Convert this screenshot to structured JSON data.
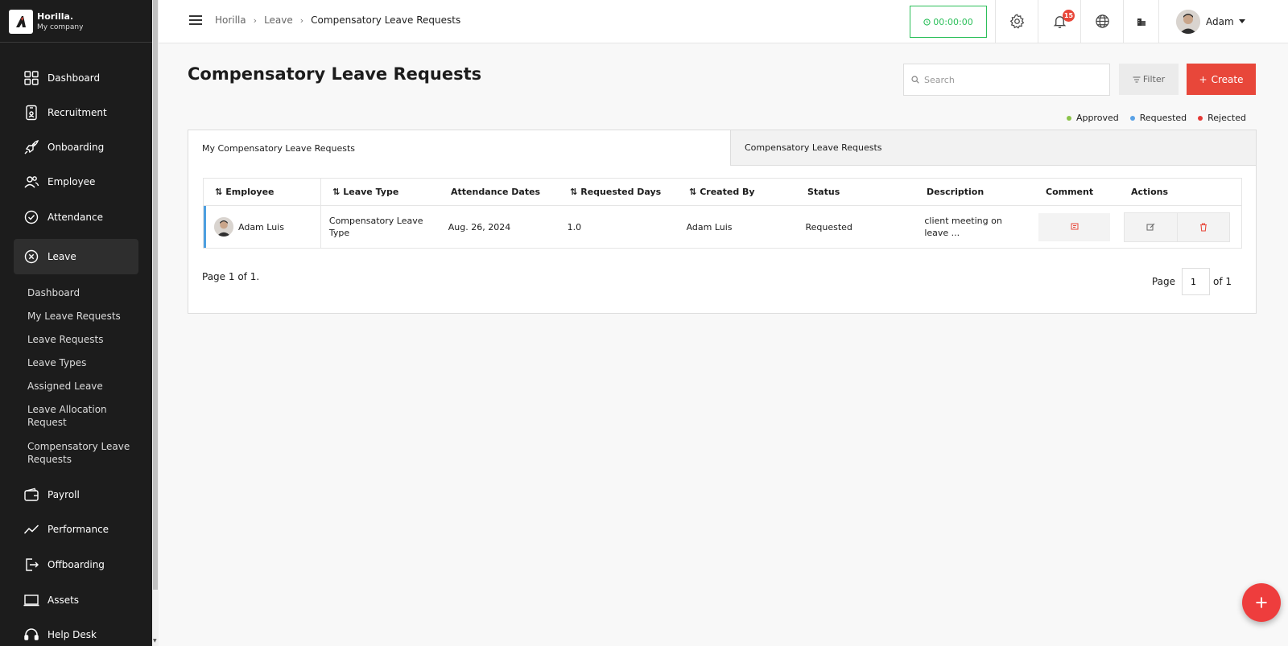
{
  "brand": {
    "name": "Horilla.",
    "company": "My company"
  },
  "sidebar": {
    "items": [
      {
        "label": "Dashboard",
        "icon": "grid-icon"
      },
      {
        "label": "Recruitment",
        "icon": "badge-icon"
      },
      {
        "label": "Onboarding",
        "icon": "rocket-icon"
      },
      {
        "label": "Employee",
        "icon": "people-icon"
      },
      {
        "label": "Attendance",
        "icon": "check-circle-icon"
      },
      {
        "label": "Leave",
        "icon": "x-circle-icon"
      },
      {
        "label": "Payroll",
        "icon": "wallet-icon"
      },
      {
        "label": "Performance",
        "icon": "trend-icon"
      },
      {
        "label": "Offboarding",
        "icon": "exit-icon"
      },
      {
        "label": "Assets",
        "icon": "laptop-icon"
      },
      {
        "label": "Help Desk",
        "icon": "headset-icon"
      }
    ],
    "leave_submenu": [
      "Dashboard",
      "My Leave Requests",
      "Leave Requests",
      "Leave Types",
      "Assigned Leave",
      "Leave Allocation Request",
      "Compensatory Leave Requests"
    ]
  },
  "header": {
    "breadcrumb": [
      "Horilla",
      "Leave",
      "Compensatory Leave Requests"
    ],
    "timer": "00:00:00",
    "notifications_count": "15",
    "user_name": "Adam"
  },
  "main": {
    "title": "Compensatory Leave Requests",
    "search_placeholder": "Search",
    "filter_label": "Filter",
    "create_label": "Create",
    "legend": [
      {
        "label": "Approved",
        "color": "#8bc34a"
      },
      {
        "label": "Requested",
        "color": "#5aa2e6"
      },
      {
        "label": "Rejected",
        "color": "#e53935"
      }
    ],
    "tabs": [
      "My Compensatory Leave Requests",
      "Compensatory Leave Requests"
    ],
    "columns": [
      "Employee",
      "Leave Type",
      "Attendance Dates",
      "Requested Days",
      "Created By",
      "Status",
      "Description",
      "Comment",
      "Actions"
    ],
    "rows": [
      {
        "employee": "Adam Luis",
        "leave_type": "Compensatory Leave Type",
        "attendance_dates": "Aug. 26, 2024",
        "requested_days": "1.0",
        "created_by": "Adam Luis",
        "status": "Requested",
        "description": "client meeting on leave ..."
      }
    ],
    "page_info": "Page 1 of 1.",
    "pager": {
      "label": "Page",
      "current": "1",
      "of_label": "of 1"
    }
  },
  "colors": {
    "accent": "#e8473a",
    "sidebar": "#1c1c1c",
    "timer": "#2cbf5a",
    "row_marker": "#4d9fe0"
  }
}
